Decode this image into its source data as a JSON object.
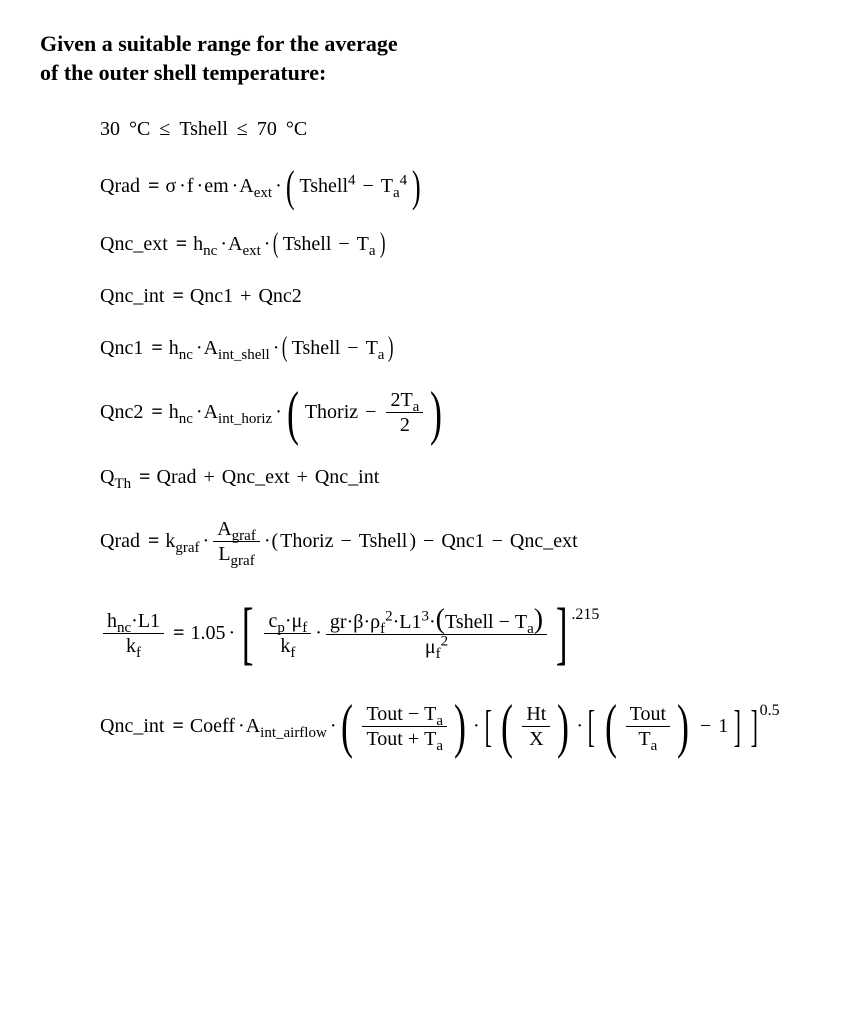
{
  "heading_line1": "Given a suitable range for the average",
  "heading_line2": "of the outer shell temperature:",
  "eq1": {
    "low": "30",
    "lowUnit": "°C",
    "le1": "≤",
    "var": "Tshell",
    "le2": "≤",
    "high": "70",
    "highUnit": "°C"
  },
  "eq2": {
    "lhs": "Qrad",
    "sigma": "σ",
    "f": "f",
    "em": "em",
    "A": "A",
    "Asub": "ext",
    "Tshell": "Tshell",
    "p1": "4",
    "Ta": "T",
    "Tasub": "a",
    "p2": "4"
  },
  "eq3": {
    "lhs": "Qnc_ext",
    "h": "h",
    "hsub": "nc",
    "A": "A",
    "Asub": "ext",
    "Tshell": "Tshell",
    "Ta": "T",
    "Tasub": "a"
  },
  "eq4": {
    "lhs": "Qnc_int",
    "r1": "Qnc1",
    "r2": "Qnc2"
  },
  "eq5": {
    "lhs": "Qnc1",
    "h": "h",
    "hsub": "nc",
    "A": "A",
    "Asub": "int_shell",
    "Tshell": "Tshell",
    "Ta": "T",
    "Tasub": "a"
  },
  "eq6": {
    "lhs": "Qnc2",
    "h": "h",
    "hsub": "nc",
    "A": "A",
    "Asub": "int_horiz",
    "Thoriz": "Thoriz",
    "num2": "2T",
    "num2sub": "a",
    "den2": "2"
  },
  "eq7": {
    "lhs": "Q",
    "lhssub": "Th",
    "r1": "Qrad",
    "r2": "Qnc_ext",
    "r3": "Qnc_int"
  },
  "eq8": {
    "lhs": "Qrad",
    "k": "k",
    "ksub": "graf",
    "An": "A",
    "Ansub": "graf",
    "Ld": "L",
    "Ldsub": "graf",
    "Thoriz": "Thoriz",
    "Tshell": "Tshell",
    "t1": "Qnc1",
    "t2": "Qnc_ext"
  },
  "eq9": {
    "hn": "h",
    "hnsub": "nc",
    "L1a": "L1",
    "kfa": "k",
    "kfasub": "f",
    "coef": "1.05",
    "cp": "c",
    "cpsub": "p",
    "muf1": "μ",
    "muf1sub": "f",
    "kfb": "k",
    "kfbsub": "f",
    "gr": "gr",
    "beta": "β",
    "rhof": "ρ",
    "rhofsub": "f",
    "rhop": "2",
    "L1b": "L1",
    "L1p": "3",
    "Tshell": "Tshell",
    "Ta": "T",
    "Tasub": "a",
    "muf2": "μ",
    "muf2sub": "f",
    "muf2p": "2",
    "power": ".215"
  },
  "eq10": {
    "lhs": "Qnc_int",
    "Coeff": "Coeff",
    "A": "A",
    "Asub": "int_airflow",
    "Tout1": "Tout",
    "Ta1": "T",
    "Ta1sub": "a",
    "Tout2": "Tout",
    "Ta2": "T",
    "Ta2sub": "a",
    "Ht": "Ht",
    "X": "X",
    "Tout3": "Tout",
    "Ta3": "T",
    "Ta3sub": "a",
    "one": "1",
    "power": "0.5"
  }
}
